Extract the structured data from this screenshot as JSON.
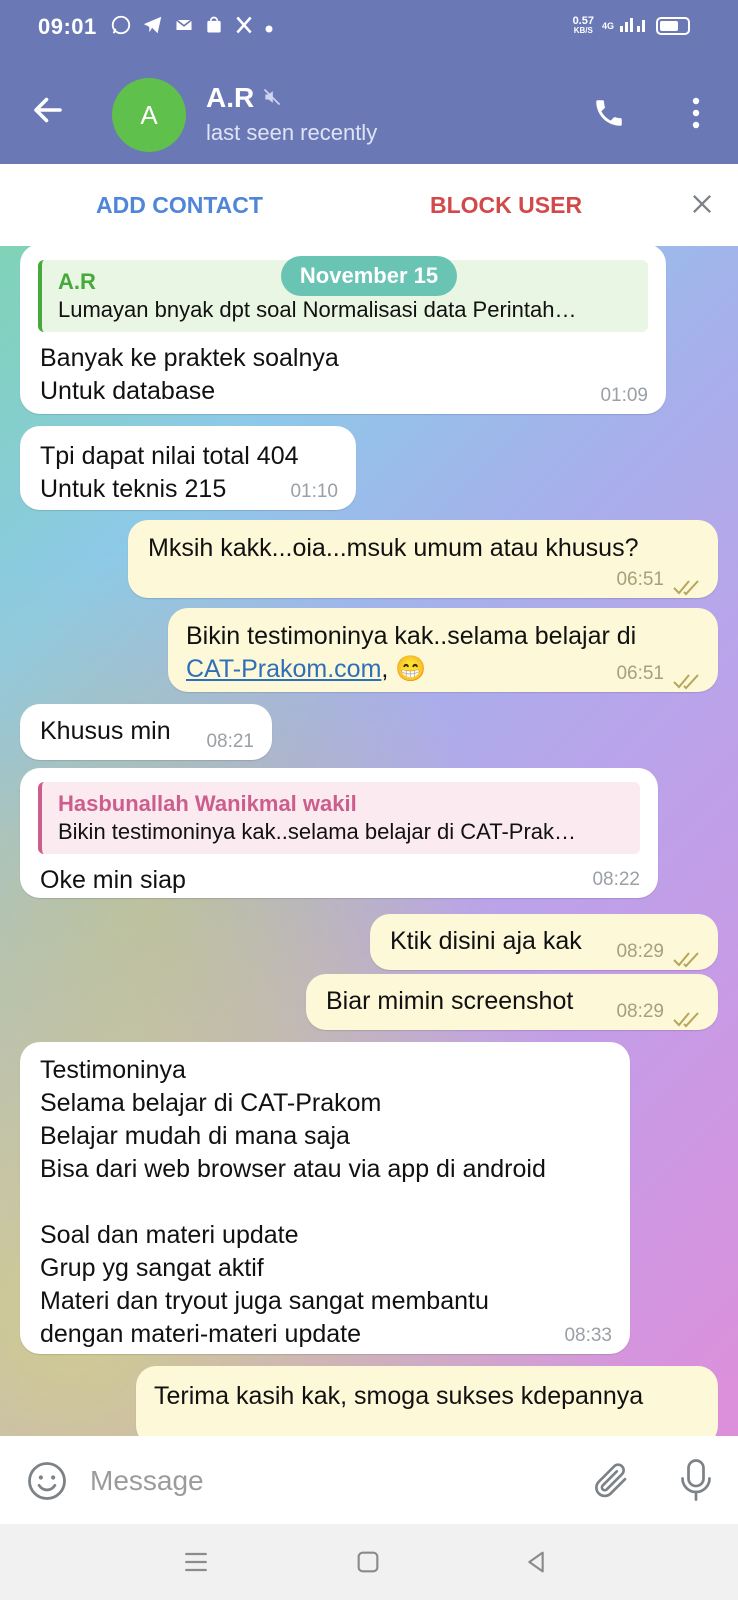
{
  "status": {
    "time": "09:01",
    "net_speed_top": "0.57",
    "net_speed_bottom": "KB/S",
    "network": "4G",
    "battery_level": 0.7
  },
  "header": {
    "name": "A.R",
    "avatar_letter": "A",
    "status": "last seen recently"
  },
  "actions": {
    "add_contact": "ADD CONTACT",
    "block_user": "BLOCK USER"
  },
  "date_chip": "November 15",
  "messages": [
    {
      "dir": "in",
      "reply_name": "A.R",
      "reply_text": "Lumayan bnyak dpt soal Normalisasi data Perintah…",
      "lines": [
        "Banyak ke praktek soalnya",
        "Untuk database"
      ],
      "time": "01:09"
    },
    {
      "dir": "in",
      "lines": [
        "Tpi dapat nilai total 404",
        "Untuk teknis 215"
      ],
      "time": "01:10"
    },
    {
      "dir": "out",
      "lines": [
        "Mksih kakk...oia...msuk umum atau khusus?"
      ],
      "time": "06:51"
    },
    {
      "dir": "out",
      "line1": "Bikin testimoninya kak..selama belajar di",
      "link": "CAT-Prakom.com",
      "after_link": ", 😁",
      "time": "06:51"
    },
    {
      "dir": "in",
      "lines": [
        "Khusus min"
      ],
      "time": "08:21"
    },
    {
      "dir": "in",
      "reply_name": "Hasbunallah Wanikmal wakil",
      "reply_text": "Bikin testimoninya kak..selama belajar di CAT-Prak…",
      "lines": [
        "Oke min siap"
      ],
      "time": "08:22"
    },
    {
      "dir": "out",
      "lines": [
        "Ktik disini aja kak"
      ],
      "time": "08:29"
    },
    {
      "dir": "out",
      "lines": [
        "Biar mimin screenshot"
      ],
      "time": "08:29"
    },
    {
      "dir": "in",
      "lines": [
        "Testimoninya",
        "Selama belajar di CAT-Prakom",
        "Belajar mudah di mana saja",
        "Bisa dari web browser atau via app di android",
        "",
        "Soal dan materi update",
        "Grup yg sangat aktif",
        "Materi dan tryout juga sangat membantu",
        "dengan materi-materi update"
      ],
      "time": "08:33"
    },
    {
      "dir": "out",
      "lines": [
        "Terima kasih kak, smoga sukses kdepannya"
      ],
      "time": ""
    }
  ],
  "input": {
    "placeholder": "Message"
  },
  "colors": {
    "header": "#6a79b6",
    "avatar": "#5fc04b",
    "add_contact": "#4f86d8",
    "block_user": "#d24949",
    "date_chip": "#69c4b4",
    "reply_green": "#47a83b",
    "reply_pink": "#cc5e8e"
  }
}
